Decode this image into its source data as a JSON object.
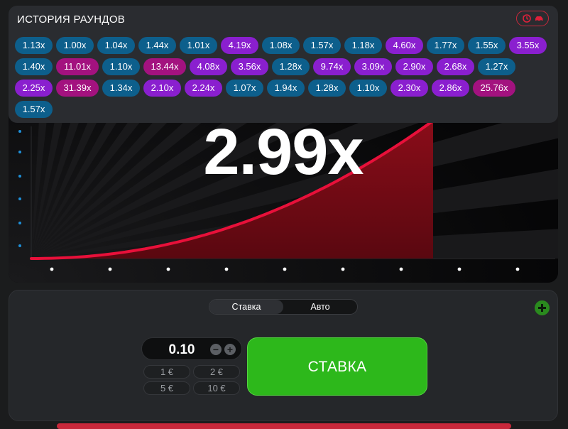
{
  "history": {
    "title": "ИСТОРИЯ РАУНДОВ",
    "rows": [
      [
        {
          "v": "1.13x",
          "c": "blue"
        },
        {
          "v": "1.00x",
          "c": "blue"
        },
        {
          "v": "1.04x",
          "c": "blue"
        },
        {
          "v": "1.44x",
          "c": "blue"
        },
        {
          "v": "1.01x",
          "c": "blue"
        },
        {
          "v": "4.19x",
          "c": "purple"
        },
        {
          "v": "1.08x",
          "c": "blue"
        },
        {
          "v": "1.57x",
          "c": "blue"
        },
        {
          "v": "1.18x",
          "c": "blue"
        },
        {
          "v": "4.60x",
          "c": "purple"
        },
        {
          "v": "1.77x",
          "c": "blue"
        },
        {
          "v": "1.55x",
          "c": "blue"
        },
        {
          "v": "3.55x",
          "c": "purple"
        }
      ],
      [
        {
          "v": "1.40x",
          "c": "blue"
        },
        {
          "v": "11.01x",
          "c": "pink"
        },
        {
          "v": "1.10x",
          "c": "blue"
        },
        {
          "v": "13.44x",
          "c": "pink"
        },
        {
          "v": "4.08x",
          "c": "purple"
        },
        {
          "v": "3.56x",
          "c": "purple"
        },
        {
          "v": "1.28x",
          "c": "blue"
        },
        {
          "v": "9.74x",
          "c": "purple"
        },
        {
          "v": "3.09x",
          "c": "purple"
        },
        {
          "v": "2.90x",
          "c": "purple"
        },
        {
          "v": "2.68x",
          "c": "purple"
        },
        {
          "v": "1.27x",
          "c": "blue"
        }
      ],
      [
        {
          "v": "2.25x",
          "c": "purple"
        },
        {
          "v": "31.39x",
          "c": "pink"
        },
        {
          "v": "1.34x",
          "c": "blue"
        },
        {
          "v": "2.10x",
          "c": "purple"
        },
        {
          "v": "2.24x",
          "c": "purple"
        },
        {
          "v": "1.07x",
          "c": "blue"
        },
        {
          "v": "1.94x",
          "c": "blue"
        },
        {
          "v": "1.28x",
          "c": "blue"
        },
        {
          "v": "1.10x",
          "c": "blue"
        },
        {
          "v": "2.30x",
          "c": "purple"
        },
        {
          "v": "2.86x",
          "c": "purple"
        },
        {
          "v": "25.76x",
          "c": "pink"
        }
      ],
      [
        {
          "v": "1.57x",
          "c": "blue"
        }
      ]
    ],
    "button_icons": [
      "history-icon",
      "car-icon"
    ]
  },
  "game": {
    "multiplier": "2.99x",
    "curve_color": "#e8103a",
    "fill_color": "#7a0b16"
  },
  "bet": {
    "tabs": [
      {
        "label": "Ставка",
        "active": true
      },
      {
        "label": "Авто",
        "active": false
      }
    ],
    "amount": "0.10",
    "minus": "−",
    "plus": "+",
    "quick": [
      "1 €",
      "2 €",
      "5 €",
      "10 €"
    ],
    "bet_label": "СТАВКА",
    "bet_color": "#2db81b"
  }
}
